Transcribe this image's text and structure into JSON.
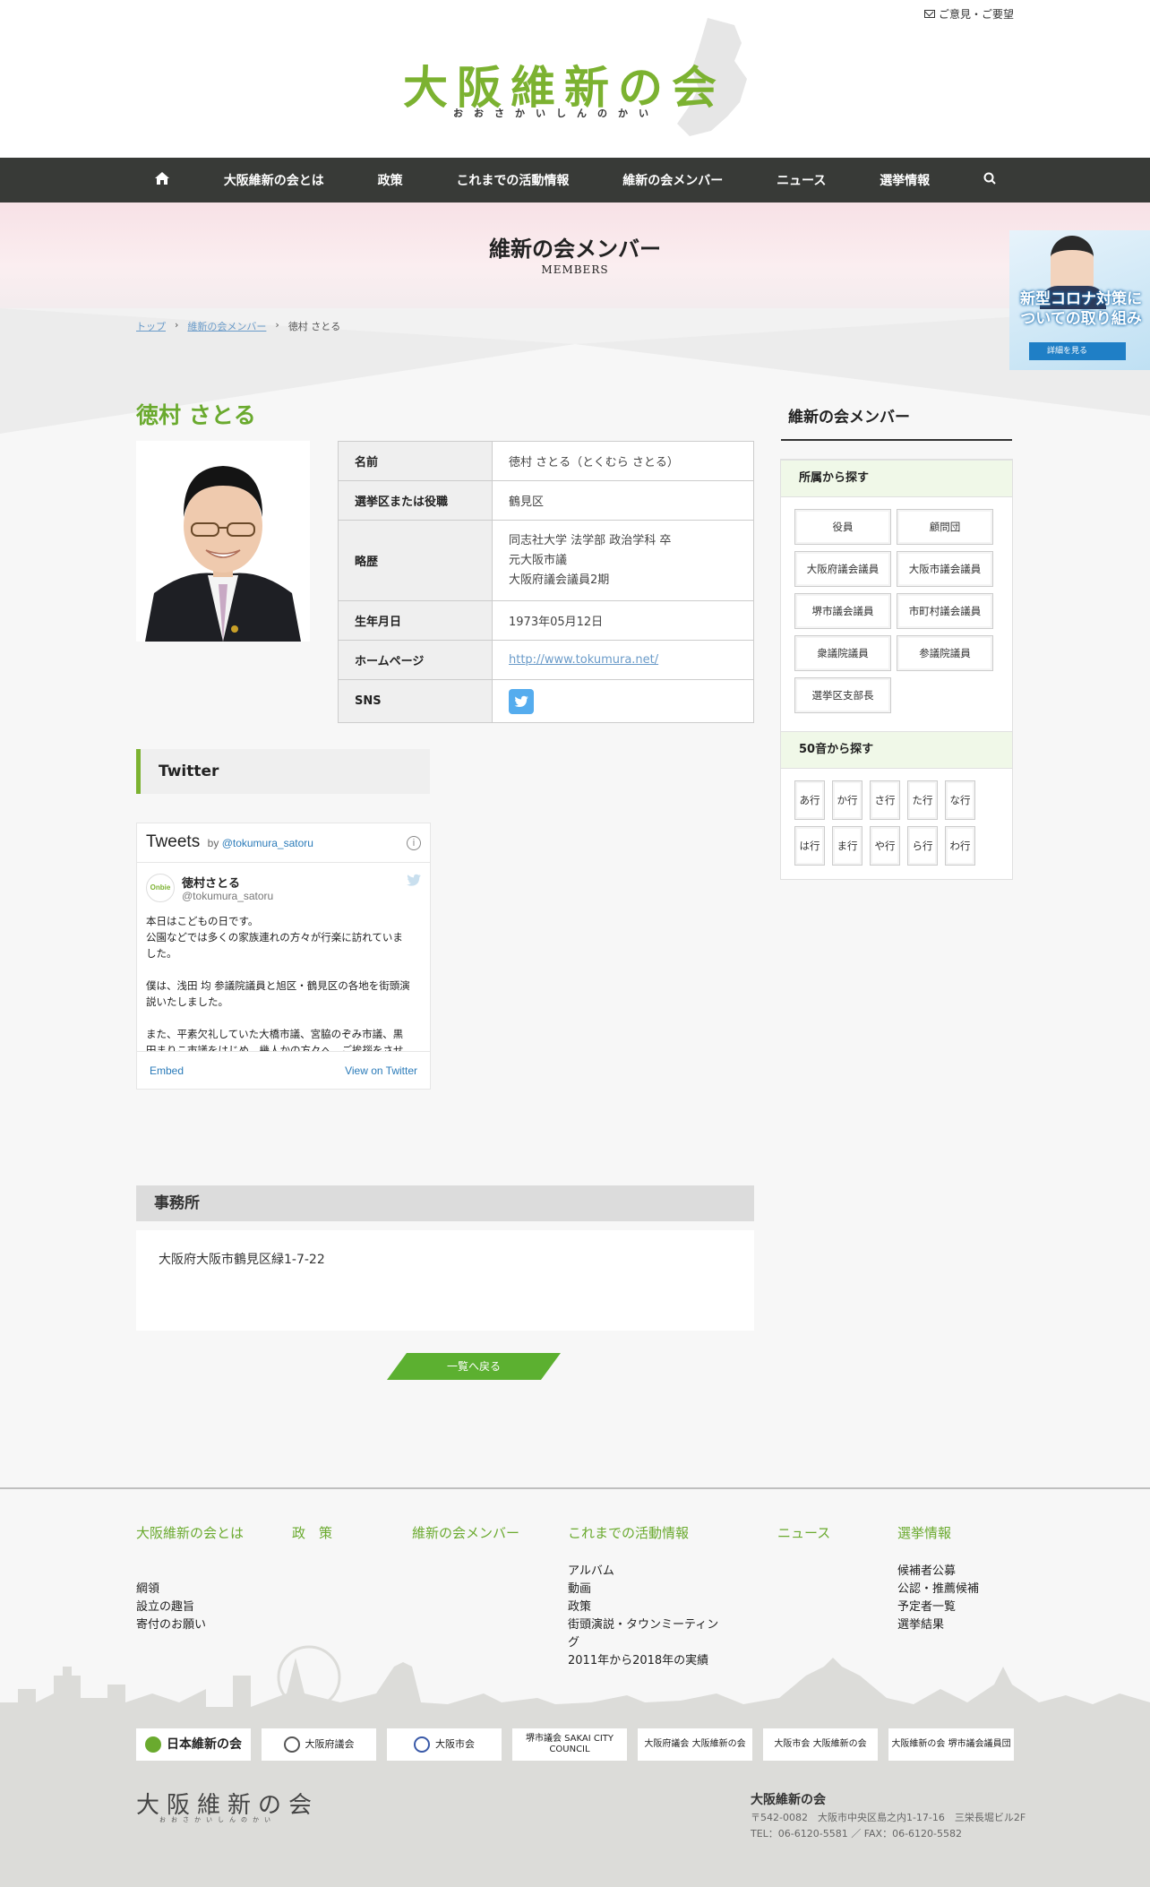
{
  "header": {
    "feedback": "ご意見・ご要望",
    "logo_title": "大阪維新の会",
    "logo_subtitle": "おおさかいしんのかい"
  },
  "nav": {
    "items": [
      {
        "label": "大阪維新の会とは"
      },
      {
        "label": "政策"
      },
      {
        "label": "これまでの活動情報"
      },
      {
        "label": "維新の会メンバー"
      },
      {
        "label": "ニュース"
      },
      {
        "label": "選挙情報"
      }
    ]
  },
  "hero": {
    "title": "維新の会メンバー",
    "subtitle": "MEMBERS"
  },
  "corona_banner": {
    "text": "新型コロナ対策についての取り組み",
    "button": "詳細を見る"
  },
  "breadcrumb": [
    "トップ",
    "維新の会メンバー",
    "徳村 さとる"
  ],
  "member": {
    "name": "徳村 さとる",
    "profile": {
      "name_label": "名前",
      "name_value": "徳村 さとる（とくむら さとる）",
      "district_label": "選挙区または役職",
      "district_value": "鶴見区",
      "history_label": "略歴",
      "history_lines": [
        "同志社大学 法学部 政治学科 卒",
        "元大阪市議",
        "大阪府議会議員2期"
      ],
      "birth_label": "生年月日",
      "birth_value": "1973年05月12日",
      "homepage_label": "ホームページ",
      "homepage_value": "http://www.tokumura.net/",
      "sns_label": "SNS"
    }
  },
  "twitter": {
    "heading": "Twitter",
    "widget_title": "Tweets",
    "widget_by": "by",
    "widget_handle": "@tokumura_satoru",
    "user_name": "徳村さとる",
    "user_handle": "@tokumura_satoru",
    "avatar_text": "Onbie",
    "lines": [
      "本日はこどもの日です。",
      "公園などでは多くの家族連れの方々が行楽に訪れていま",
      "した。",
      "",
      "僕は、浅田 均 参議院議員と旭区・鶴見区の各地を街頭演",
      "説いたしました。",
      "",
      "また、平素欠礼していた大橋市議、宮脇のぞみ市議、黒",
      "田まりこ市議をはじめ、幾人かの方々へ、ご挨拶をさせ"
    ],
    "embed": "Embed",
    "view_on_twitter": "View on Twitter"
  },
  "office": {
    "heading": "事務所",
    "address": "大阪府大阪市鶴見区緑1-7-22"
  },
  "back_button": "一覧へ戻る",
  "sidebar": {
    "title": "維新の会メンバー",
    "affiliation_heading": "所属から探す",
    "affiliations": [
      "役員",
      "顧問団",
      "大阪府議会議員",
      "大阪市議会議員",
      "堺市議会議員",
      "市町村議会議員",
      "衆議院議員",
      "参議院議員",
      "選挙区支部長"
    ],
    "kana_heading": "50音から探す",
    "kana": [
      "あ行",
      "か行",
      "さ行",
      "た行",
      "な行",
      "は行",
      "ま行",
      "や行",
      "ら行",
      "わ行"
    ]
  },
  "footer": {
    "col1": {
      "title": "大阪維新の会とは",
      "links": [
        "綱領",
        "設立の趣旨",
        "寄付のお願い"
      ]
    },
    "col2": {
      "title": "政　策"
    },
    "col3": {
      "title": "維新の会メンバー"
    },
    "col4": {
      "title": "これまでの活動情報",
      "links": [
        "アルバム",
        "動画",
        "政策",
        "街頭演説・タウンミーティング",
        "2011年から2018年の実績"
      ]
    },
    "col5": {
      "title": "ニュース"
    },
    "col6": {
      "title": "選挙情報",
      "links": [
        "候補者公募",
        "公認・推薦候補",
        "予定者一覧",
        "選挙結果"
      ]
    },
    "banners": [
      "日本維新の会",
      "大阪府議会",
      "大阪市会",
      "堺市議会 SAKAI CITY COUNCIL",
      "大阪府議会 大阪維新の会",
      "大阪市会 大阪維新の会",
      "大阪維新の会 堺市議会議員団"
    ],
    "logo": "大阪維新の会",
    "logo_sub": "おおさかいしんのかい",
    "org": "大阪維新の会",
    "address": "〒542-0082　大阪市中央区島之内1-17-16　三栄長堀ビル2F",
    "tel": "TEL：06-6120-5581 ／ FAX：06-6120-5582"
  }
}
